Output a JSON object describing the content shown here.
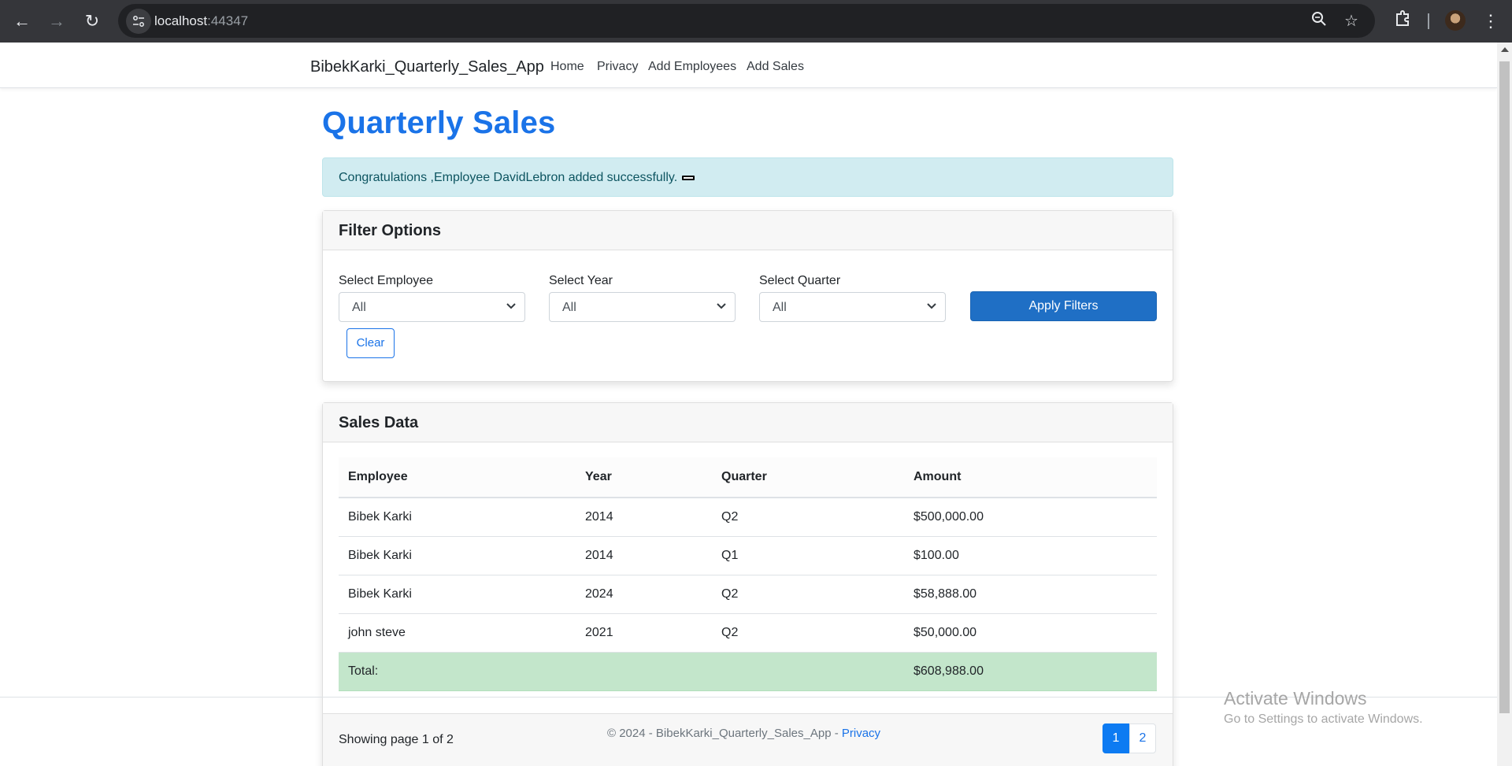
{
  "browser": {
    "url_host": "localhost",
    "url_port": ":44347"
  },
  "navbar": {
    "brand": "BibekKarki_Quarterly_Sales_App",
    "links": [
      "Home",
      "Privacy",
      "Add Employees",
      "Add Sales"
    ]
  },
  "page": {
    "title": "Quarterly Sales",
    "alert": "Congratulations ,Employee DavidLebron added successfully."
  },
  "filters": {
    "header": "Filter Options",
    "employee_label": "Select Employee",
    "employee_value": "All",
    "year_label": "Select Year",
    "year_value": "All",
    "quarter_label": "Select Quarter",
    "quarter_value": "All",
    "apply_label": "Apply Filters",
    "clear_label": "Clear"
  },
  "sales": {
    "header": "Sales Data",
    "columns": [
      "Employee",
      "Year",
      "Quarter",
      "Amount"
    ],
    "rows": [
      [
        "Bibek Karki",
        "2014",
        "Q2",
        "$500,000.00"
      ],
      [
        "Bibek Karki",
        "2014",
        "Q1",
        "$100.00"
      ],
      [
        "Bibek Karki",
        "2024",
        "Q2",
        "$58,888.00"
      ],
      [
        "john steve",
        "2021",
        "Q2",
        "$50,000.00"
      ]
    ],
    "total_label": "Total:",
    "total_value": "$608,988.00",
    "page_info": "Showing page 1 of 2",
    "pages": [
      "1",
      "2"
    ]
  },
  "footer": {
    "text": "© 2024 - BibekKarki_Quarterly_Sales_App - ",
    "privacy": "Privacy"
  },
  "watermark": {
    "line1": "Activate Windows",
    "line2": "Go to Settings to activate Windows."
  }
}
